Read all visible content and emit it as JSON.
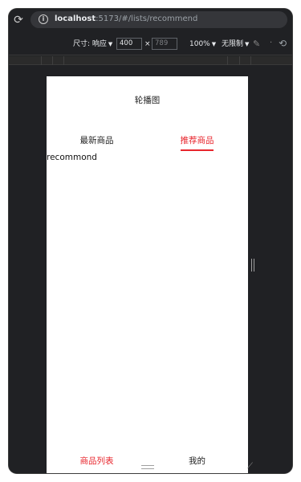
{
  "browser": {
    "url_host": "localhost",
    "url_rest": ":5173/#/lists/recommend"
  },
  "device_toolbar": {
    "dimensions_label": "尺寸: 响应",
    "width_value": "400",
    "times": "×",
    "height_placeholder": "789",
    "zoom": "100%",
    "throttle": "无限制"
  },
  "app": {
    "carousel_label": "轮播图",
    "tabs": [
      {
        "label": "最新商品",
        "active": false
      },
      {
        "label": "推荐商品",
        "active": true
      }
    ],
    "content_text": "recommond",
    "bottom_nav": [
      {
        "label": "商品列表",
        "active": true
      },
      {
        "label": "我的",
        "active": false
      }
    ]
  },
  "colors": {
    "accent": "#e8262d",
    "chrome_bg": "#202124"
  }
}
